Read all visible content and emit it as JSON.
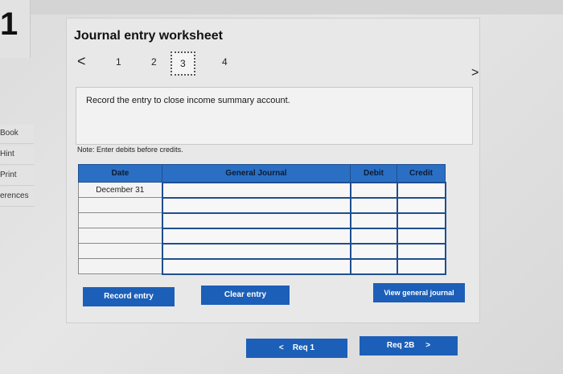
{
  "page": {
    "number": "1"
  },
  "sidebar": {
    "items": [
      {
        "label": "Book"
      },
      {
        "label": "Hint"
      },
      {
        "label": "Print"
      },
      {
        "label": "erences"
      }
    ]
  },
  "worksheet": {
    "title": "Journal entry worksheet",
    "nav": {
      "prev": "<",
      "next": ">",
      "tabs": [
        "1",
        "2",
        "3",
        "4"
      ],
      "active_tab": "3"
    },
    "instruction": "Record the entry to close income summary account.",
    "note": "Note: Enter debits before credits."
  },
  "table": {
    "columns": [
      "Date",
      "General Journal",
      "Debit",
      "Credit"
    ],
    "rows": [
      {
        "date": "December 31",
        "account": "",
        "debit": "",
        "credit": ""
      },
      {
        "date": "",
        "account": "",
        "debit": "",
        "credit": ""
      },
      {
        "date": "",
        "account": "",
        "debit": "",
        "credit": ""
      },
      {
        "date": "",
        "account": "",
        "debit": "",
        "credit": ""
      },
      {
        "date": "",
        "account": "",
        "debit": "",
        "credit": ""
      },
      {
        "date": "",
        "account": "",
        "debit": "",
        "credit": ""
      }
    ]
  },
  "buttons": {
    "record": "Record entry",
    "clear": "Clear entry",
    "view": "View general journal"
  },
  "footer_nav": {
    "prev_label": "Req 1",
    "next_label": "Req 2B",
    "prev_icon": "<",
    "next_icon": ">"
  },
  "colors": {
    "header_blue": "#2a6fc4",
    "button_blue": "#1c5fb8"
  }
}
